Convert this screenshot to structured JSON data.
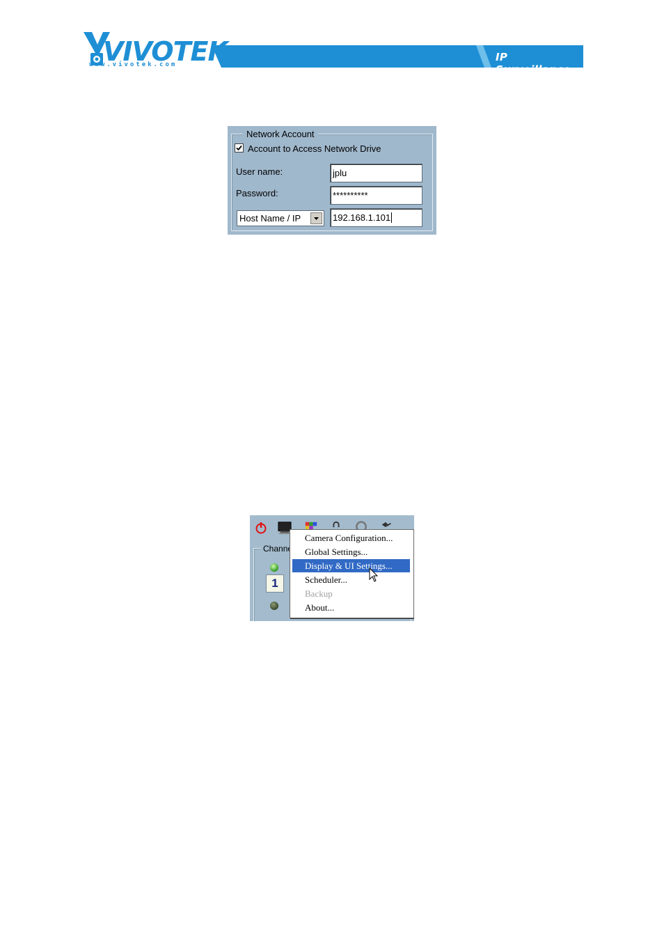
{
  "header": {
    "brand": "VIVOTEK",
    "url": "www.vivotek.com",
    "tagline": "IP Surveillance",
    "brand_color": "#1E8FD5"
  },
  "network_account": {
    "legend": "Network Account",
    "checkbox_label": "Account to Access Network Drive",
    "checkbox_checked": true,
    "username_label": "User name:",
    "username_value": "jplu",
    "password_label": "Password:",
    "password_value": "**********",
    "host_select_value": "Host Name / IP",
    "host_value": "192.168.1.101",
    "panel_color": "#A0B8CC"
  },
  "context_menu_screen": {
    "toolbar_icons": [
      "power-icon",
      "monitor-icon",
      "color-grid-icon",
      "lock-icon",
      "gear-icon",
      "tool-icon"
    ],
    "channel_label": "Channe",
    "channel_number": "1",
    "menu_items": [
      {
        "label": "Camera Configuration...",
        "state": "normal"
      },
      {
        "label": "Global Settings...",
        "state": "normal"
      },
      {
        "label": "Display & UI Settings...",
        "state": "selected"
      },
      {
        "label": "Scheduler...",
        "state": "normal"
      },
      {
        "label": "Backup",
        "state": "disabled"
      },
      {
        "label": "About...",
        "state": "normal"
      }
    ],
    "selection_color": "#316AC5"
  }
}
